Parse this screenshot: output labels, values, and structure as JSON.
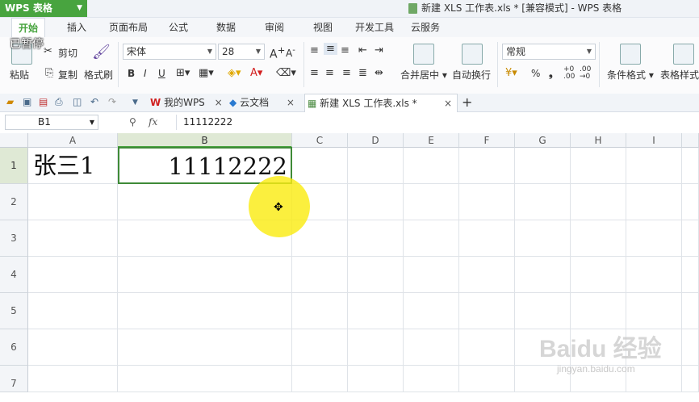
{
  "app": {
    "button_label": "WPS 表格",
    "window_title": "新建 XLS 工作表.xls * [兼容模式] - WPS 表格",
    "paused_overlay": "已暂停"
  },
  "ribbon_tabs": [
    "开始",
    "插入",
    "页面布局",
    "公式",
    "数据",
    "审阅",
    "视图",
    "开发工具",
    "云服务"
  ],
  "ribbon": {
    "cut": "剪切",
    "paste": "粘贴",
    "copy": "复制",
    "format_painter": "格式刷",
    "font_name": "宋体",
    "font_size": "28",
    "bold": "B",
    "italic": "I",
    "underline": "U",
    "grow_font": "A",
    "shrink_font": "A",
    "merge_center": "合并居中",
    "wrap_text": "自动换行",
    "number_format": "常规",
    "percent": "%",
    "comma": "❟",
    "inc_decimal": ".00",
    "dec_decimal": ".00",
    "conditional_format": "条件格式",
    "table_style": "表格样式"
  },
  "doc_tabs": [
    {
      "label": "我的WPS"
    },
    {
      "label": "云文档"
    },
    {
      "label": "新建 XLS 工作表.xls *"
    }
  ],
  "formula_bar": {
    "name_box": "B1",
    "fx": "fx",
    "formula": "11112222"
  },
  "sheet": {
    "columns": [
      "A",
      "B",
      "C",
      "D",
      "E",
      "F",
      "G",
      "H",
      "I"
    ],
    "rows": [
      "1",
      "2",
      "3",
      "4",
      "5",
      "6",
      "7"
    ],
    "cells": {
      "A1": "张三1",
      "B1": "11112222"
    },
    "selected_cell": "B1",
    "selection_color": "#3f8a37"
  },
  "overlay": {
    "cursor_highlight_color": "#faec14"
  },
  "watermark": {
    "main": "Baidu 经验",
    "sub": "jingyan.baidu.com"
  }
}
